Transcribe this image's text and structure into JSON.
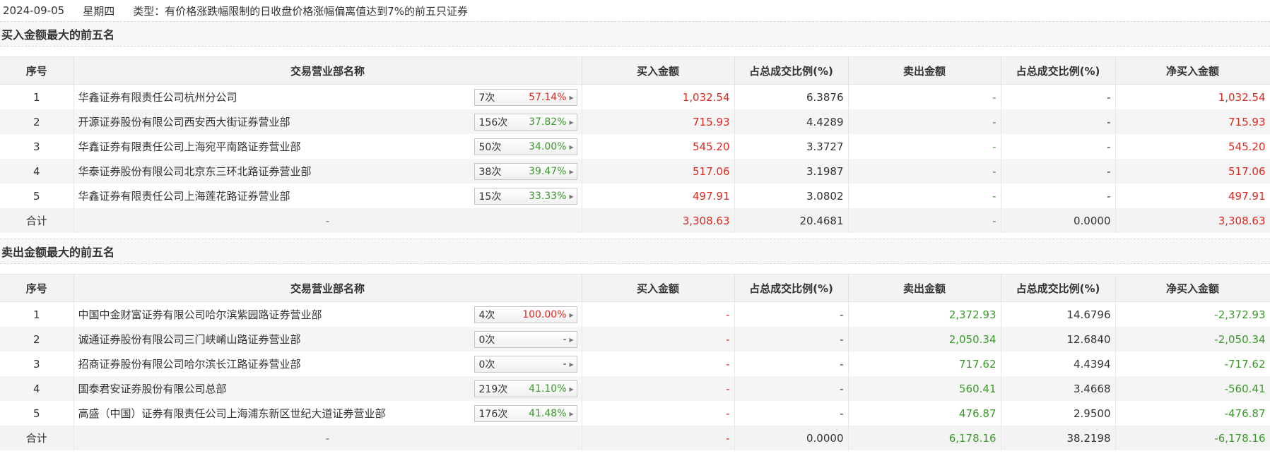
{
  "header": {
    "date": "2024-09-05",
    "weekday": "星期四",
    "type_text": "类型：有价格涨跌幅限制的日收盘价格涨幅偏离值达到7%的前五只证券"
  },
  "columns": {
    "idx": "序号",
    "name": "交易营业部名称",
    "buy": "买入金额",
    "buy_ratio": "占总成交比例(%)",
    "sell": "卖出金额",
    "sell_ratio": "占总成交比例(%)",
    "net": "净买入金额"
  },
  "buy_section": {
    "title": "买入金额最大的前五名",
    "rows": [
      {
        "idx": "1",
        "name": "华鑫证券有限责任公司杭州分公司",
        "count": "7次",
        "pct": "57.14%",
        "pct_color": "red",
        "buy": "1,032.54",
        "buy_ratio": "6.3876",
        "sell": "-",
        "sell_ratio": "-",
        "net": "1,032.54"
      },
      {
        "idx": "2",
        "name": "开源证券股份有限公司西安西大街证券营业部",
        "count": "156次",
        "pct": "37.82%",
        "pct_color": "green",
        "buy": "715.93",
        "buy_ratio": "4.4289",
        "sell": "-",
        "sell_ratio": "-",
        "net": "715.93"
      },
      {
        "idx": "3",
        "name": "华鑫证券有限责任公司上海宛平南路证券营业部",
        "count": "50次",
        "pct": "34.00%",
        "pct_color": "green",
        "buy": "545.20",
        "buy_ratio": "3.3727",
        "sell": "-",
        "sell_ratio": "-",
        "net": "545.20"
      },
      {
        "idx": "4",
        "name": "华泰证券股份有限公司北京东三环北路证券营业部",
        "count": "38次",
        "pct": "39.47%",
        "pct_color": "green",
        "buy": "517.06",
        "buy_ratio": "3.1987",
        "sell": "-",
        "sell_ratio": "-",
        "net": "517.06"
      },
      {
        "idx": "5",
        "name": "华鑫证券有限责任公司上海莲花路证券营业部",
        "count": "15次",
        "pct": "33.33%",
        "pct_color": "green",
        "buy": "497.91",
        "buy_ratio": "3.0802",
        "sell": "-",
        "sell_ratio": "-",
        "net": "497.91"
      }
    ],
    "total": {
      "label": "合计",
      "name": "-",
      "buy": "3,308.63",
      "buy_ratio": "20.4681",
      "sell": "-",
      "sell_ratio": "0.0000",
      "net": "3,308.63"
    }
  },
  "sell_section": {
    "title": "卖出金额最大的前五名",
    "rows": [
      {
        "idx": "1",
        "name": "中国中金财富证券有限公司哈尔滨紫园路证券营业部",
        "count": "4次",
        "pct": "100.00%",
        "pct_color": "red",
        "buy": "-",
        "buy_ratio": "-",
        "sell": "2,372.93",
        "sell_ratio": "14.6796",
        "net": "-2,372.93"
      },
      {
        "idx": "2",
        "name": "诚通证券股份有限公司三门峡崤山路证券营业部",
        "count": "0次",
        "pct": "-",
        "pct_color": "plain",
        "buy": "-",
        "buy_ratio": "-",
        "sell": "2,050.34",
        "sell_ratio": "12.6840",
        "net": "-2,050.34"
      },
      {
        "idx": "3",
        "name": "招商证券股份有限公司哈尔滨长江路证券营业部",
        "count": "0次",
        "pct": "-",
        "pct_color": "plain",
        "buy": "-",
        "buy_ratio": "-",
        "sell": "717.62",
        "sell_ratio": "4.4394",
        "net": "-717.62"
      },
      {
        "idx": "4",
        "name": "国泰君安证券股份有限公司总部",
        "count": "219次",
        "pct": "41.10%",
        "pct_color": "green",
        "buy": "-",
        "buy_ratio": "-",
        "sell": "560.41",
        "sell_ratio": "3.4668",
        "net": "-560.41"
      },
      {
        "idx": "5",
        "name": "高盛（中国）证券有限责任公司上海浦东新区世纪大道证券营业部",
        "count": "176次",
        "pct": "41.48%",
        "pct_color": "green",
        "buy": "-",
        "buy_ratio": "-",
        "sell": "476.87",
        "sell_ratio": "2.9500",
        "net": "-476.87"
      }
    ],
    "total": {
      "label": "合计",
      "name": "-",
      "buy": "-",
      "buy_ratio": "0.0000",
      "sell": "6,178.16",
      "sell_ratio": "38.2198",
      "net": "-6,178.16"
    }
  },
  "colors": {
    "red": "#e0281e",
    "green": "#3a9a2a"
  }
}
